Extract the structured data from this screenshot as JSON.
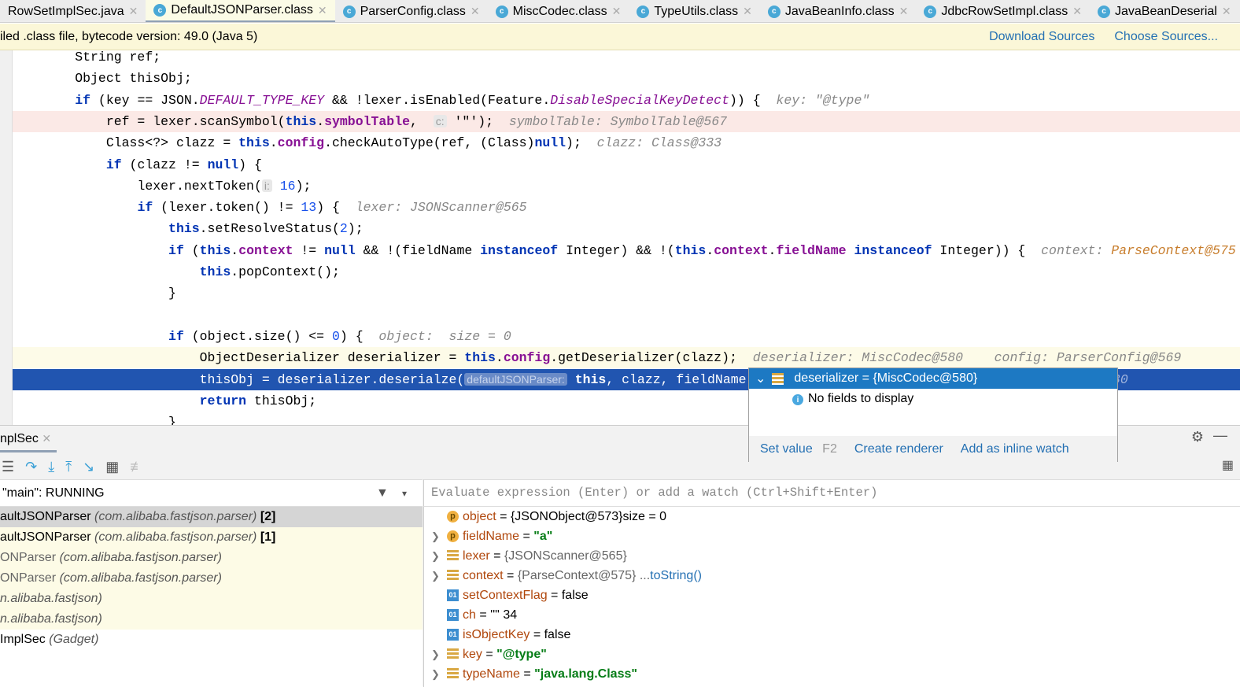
{
  "tabs": [
    {
      "label": "RowSetImplSec.java",
      "icon": "none"
    },
    {
      "label": "DefaultJSONParser.class",
      "icon": "class-icon",
      "active": true
    },
    {
      "label": "ParserConfig.class",
      "icon": "class-icon"
    },
    {
      "label": "MiscCodec.class",
      "icon": "class-icon"
    },
    {
      "label": "TypeUtils.class",
      "icon": "class-icon"
    },
    {
      "label": "JavaBeanInfo.class",
      "icon": "class-icon"
    },
    {
      "label": "JdbcRowSetImpl.class",
      "icon": "class-icon"
    },
    {
      "label": "JavaBeanDeserial",
      "icon": "class-icon"
    }
  ],
  "banner": {
    "text": "iled .class file, bytecode version: 49.0 (Java 5)",
    "download": "Download Sources",
    "choose": "Choose Sources..."
  },
  "code": [
    {
      "indent": 2,
      "t": [
        [
          "String ref;",
          ""
        ]
      ]
    },
    {
      "indent": 2,
      "t": [
        [
          "Object thisObj;",
          ""
        ]
      ]
    },
    {
      "indent": 2,
      "t": [
        [
          "if",
          "kw"
        ],
        [
          " (key == JSON.",
          ""
        ],
        [
          "DEFAULT_TYPE_KEY",
          "it"
        ],
        [
          " && !lexer.isEnabled(Feature.",
          ""
        ],
        [
          "DisableSpecialKeyDetect",
          "it"
        ],
        [
          ")) {  ",
          ""
        ],
        [
          "key: \"@type\"",
          "hint"
        ]
      ]
    },
    {
      "indent": 3,
      "cls": "hl-red",
      "t": [
        [
          "ref = lexer.scanSymbol(",
          ""
        ],
        [
          "this",
          "kw"
        ],
        [
          ".",
          ""
        ],
        [
          "symbolTable",
          "fld"
        ],
        [
          ",  ",
          ""
        ],
        [
          "c:",
          "pill"
        ],
        [
          " '\"');  ",
          ""
        ],
        [
          "symbolTable: SymbolTable@567",
          "hint"
        ]
      ]
    },
    {
      "indent": 3,
      "t": [
        [
          "Class<?> clazz = ",
          ""
        ],
        [
          "this",
          "kw"
        ],
        [
          ".",
          ""
        ],
        [
          "config",
          "fld"
        ],
        [
          ".checkAutoType(ref, (Class)",
          ""
        ],
        [
          "null",
          "kw"
        ],
        [
          ");  ",
          ""
        ],
        [
          "clazz: Class@333",
          "hint"
        ]
      ]
    },
    {
      "indent": 3,
      "t": [
        [
          "if",
          "kw"
        ],
        [
          " (clazz != ",
          ""
        ],
        [
          "null",
          "kw"
        ],
        [
          ") {",
          ""
        ]
      ]
    },
    {
      "indent": 4,
      "t": [
        [
          "lexer.nextToken(",
          ""
        ],
        [
          "i:",
          "pill"
        ],
        [
          " ",
          ""
        ],
        [
          "16",
          "num"
        ],
        [
          ");",
          ""
        ]
      ]
    },
    {
      "indent": 4,
      "t": [
        [
          "if",
          "kw"
        ],
        [
          " (lexer.token() != ",
          ""
        ],
        [
          "13",
          "num"
        ],
        [
          ") {  ",
          ""
        ],
        [
          "lexer: JSONScanner@565",
          "hint"
        ]
      ]
    },
    {
      "indent": 5,
      "t": [
        [
          "this",
          "kw"
        ],
        [
          ".setResolveStatus(",
          ""
        ],
        [
          "2",
          "num"
        ],
        [
          ");",
          ""
        ]
      ]
    },
    {
      "indent": 5,
      "t": [
        [
          "if",
          "kw"
        ],
        [
          " (",
          ""
        ],
        [
          "this",
          "kw"
        ],
        [
          ".",
          ""
        ],
        [
          "context",
          "fld"
        ],
        [
          " != ",
          ""
        ],
        [
          "null",
          "kw"
        ],
        [
          " && !(fieldName ",
          ""
        ],
        [
          "instanceof",
          "kw"
        ],
        [
          " Integer) && !(",
          ""
        ],
        [
          "this",
          "kw"
        ],
        [
          ".",
          ""
        ],
        [
          "context",
          "fld"
        ],
        [
          ".",
          ""
        ],
        [
          "fieldName",
          "fld"
        ],
        [
          " ",
          ""
        ],
        [
          "instanceof",
          "kw"
        ],
        [
          " Integer)) {  ",
          ""
        ],
        [
          "context: ",
          "hint"
        ],
        [
          "ParseContext@575",
          "hint2"
        ]
      ]
    },
    {
      "indent": 6,
      "t": [
        [
          "this",
          "kw"
        ],
        [
          ".popContext();",
          ""
        ]
      ]
    },
    {
      "indent": 5,
      "t": [
        [
          "}",
          ""
        ]
      ]
    },
    {
      "indent": 0,
      "t": []
    },
    {
      "indent": 5,
      "t": [
        [
          "if",
          "kw"
        ],
        [
          " (object.size() <= ",
          ""
        ],
        [
          "0",
          "num"
        ],
        [
          ") {  ",
          ""
        ],
        [
          "object:  size = 0",
          "hint"
        ]
      ]
    },
    {
      "indent": 6,
      "cls": "hl-yel",
      "t": [
        [
          "ObjectDeserializer deserializer = ",
          ""
        ],
        [
          "this",
          "kw"
        ],
        [
          ".",
          ""
        ],
        [
          "config",
          "fld"
        ],
        [
          ".getDeserializer(clazz);  ",
          ""
        ],
        [
          "deserializer: MiscCodec@580    config: ParserConfig@569",
          "hint"
        ]
      ]
    },
    {
      "indent": 6,
      "cls": "hl-sel",
      "t": [
        [
          "thisObj = deserializer.deserialze(",
          ""
        ],
        [
          "defaultJSONParser:",
          "pill"
        ],
        [
          " ",
          ""
        ],
        [
          "this",
          "kw"
        ],
        [
          ", clazz, fieldName);                    ",
          ""
        ],
        [
          "deserializer: MiscCodec@580",
          "hint"
        ]
      ]
    },
    {
      "indent": 6,
      "t": [
        [
          "return",
          "kw"
        ],
        [
          " thisObj;",
          ""
        ]
      ]
    },
    {
      "indent": 5,
      "t": [
        [
          "}",
          ""
        ]
      ]
    }
  ],
  "popup": {
    "title": "deserializer = {MiscCodec@580}",
    "message": "No fields to display",
    "set_value": "Set value",
    "set_value_key": "F2",
    "create_renderer": "Create renderer",
    "add_inline_watch": "Add as inline watch"
  },
  "debug": {
    "tab": "nplSec",
    "thread": "\"main\": RUNNING",
    "eval_placeholder": "Evaluate expression (Enter) or add a watch (Ctrl+Shift+Enter)"
  },
  "frames": [
    {
      "name": "aultJSONParser",
      "pkg": "(com.alibaba.fastjson.parser)",
      "suffix": "[2]",
      "state": "sel"
    },
    {
      "name": "aultJSONParser",
      "pkg": "(com.alibaba.fastjson.parser)",
      "suffix": "[1]",
      "state": "lib"
    },
    {
      "name": "ONParser",
      "pkg": "(com.alibaba.fastjson.parser)",
      "suffix": "",
      "state": "lib dim"
    },
    {
      "name": "ONParser",
      "pkg": "(com.alibaba.fastjson.parser)",
      "suffix": "",
      "state": "lib dim"
    },
    {
      "name": "",
      "pkg": "n.alibaba.fastjson)",
      "suffix": "",
      "state": "lib dim"
    },
    {
      "name": "",
      "pkg": "n.alibaba.fastjson)",
      "suffix": "",
      "state": "lib dim"
    },
    {
      "name": "ImplSec",
      "pkg": "(Gadget)",
      "suffix": "",
      "state": ""
    }
  ],
  "variables": [
    {
      "icon": "p",
      "expand": false,
      "name": "object",
      "value": "{JSONObject@573}",
      "extra": " size = 0",
      "type": "plain"
    },
    {
      "icon": "p",
      "expand": true,
      "name": "fieldName",
      "value": "\"a\"",
      "extra": "",
      "type": "str"
    },
    {
      "icon": "f",
      "expand": true,
      "name": "lexer",
      "value": "{JSONScanner@565}",
      "extra": "",
      "type": "gray"
    },
    {
      "icon": "f",
      "expand": true,
      "name": "context",
      "value": "{ParseContext@575} ...",
      "extra": " toString()",
      "type": "gray",
      "link": true
    },
    {
      "icon": "o",
      "expand": false,
      "name": "setContextFlag",
      "value": "false",
      "extra": "",
      "type": "plain"
    },
    {
      "icon": "o",
      "expand": false,
      "name": "ch",
      "value": "'\"' 34",
      "extra": "",
      "type": "plain"
    },
    {
      "icon": "o",
      "expand": false,
      "name": "isObjectKey",
      "value": "false",
      "extra": "",
      "type": "plain"
    },
    {
      "icon": "f",
      "expand": true,
      "name": "key",
      "value": "\"@type\"",
      "extra": "",
      "type": "str"
    },
    {
      "icon": "f",
      "expand": true,
      "name": "typeName",
      "value": "\"java.lang.Class\"",
      "extra": "",
      "type": "str"
    }
  ]
}
